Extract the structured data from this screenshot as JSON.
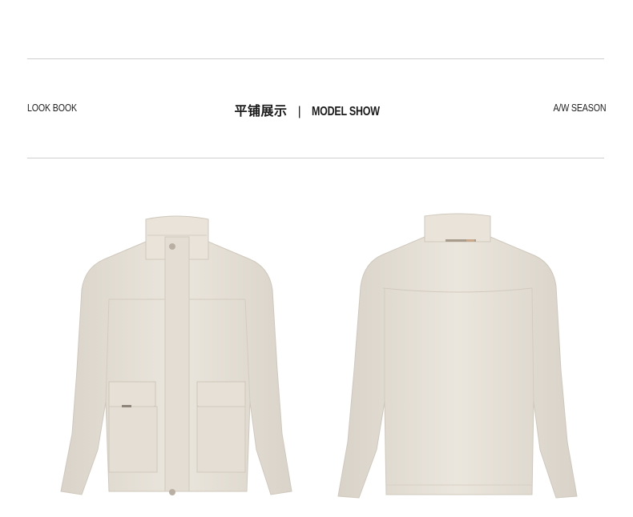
{
  "header": {
    "left_label": "LOOK BOOK",
    "title_cn": "平铺展示",
    "separator": "|",
    "title_en": "MODEL SHOW",
    "right_label": "A/W SEASON"
  },
  "products": [
    {
      "view": "front",
      "color": "#e6e0d6"
    },
    {
      "view": "back",
      "color": "#e6e0d6"
    }
  ]
}
